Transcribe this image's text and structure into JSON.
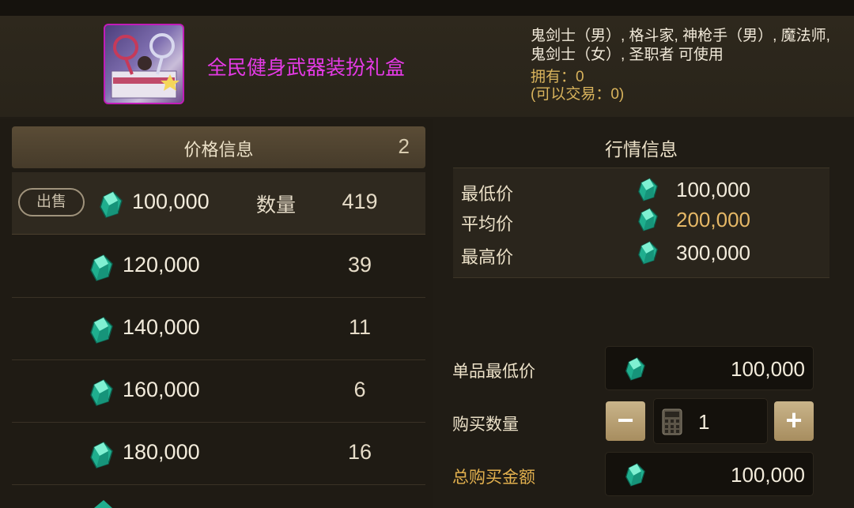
{
  "item": {
    "name": "全民健身武器装扮礼盒",
    "usable_by": "鬼剑士（男）, 格斗家, 神枪手（男）, 魔法师, 鬼剑士（女）, 圣职者 可使用",
    "owned": "拥有：0",
    "tradable": "(可以交易：0)",
    "icon": "gift-box-icon"
  },
  "listing": {
    "header": "价格信息",
    "page": "2",
    "sell_label": "出售",
    "qty_label": "数量",
    "rows": [
      {
        "price": "100,000",
        "count": "419"
      },
      {
        "price": "120,000",
        "count": "39"
      },
      {
        "price": "140,000",
        "count": "11"
      },
      {
        "price": "160,000",
        "count": "6"
      },
      {
        "price": "180,000",
        "count": "16"
      }
    ]
  },
  "market": {
    "title": "行情信息",
    "min_label": "最低价",
    "min": "100,000",
    "avg_label": "平均价",
    "avg": "200,000",
    "max_label": "最高价",
    "max": "300,000"
  },
  "purchase": {
    "unit_min_label": "单品最低价",
    "unit_min": "100,000",
    "qty_label": "购买数量",
    "qty": "1",
    "minus": "−",
    "plus": "+",
    "total_label": "总购买金额",
    "total": "100,000"
  },
  "colors": {
    "item_name": "#e53ae6",
    "gem": "#2fd3b0",
    "accent_gold": "#e2b04e"
  }
}
